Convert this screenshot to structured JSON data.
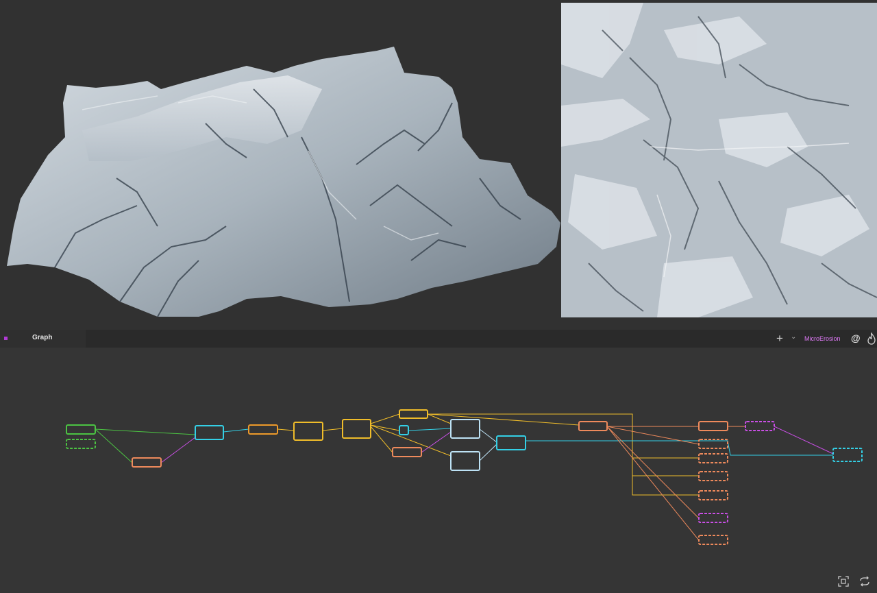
{
  "tabs": {
    "graph_label": "Graph"
  },
  "toolbar": {
    "active_graph": "MicroErosion",
    "add_icon": "plus-icon",
    "dropdown_icon": "chevron-down-icon",
    "at_icon": "at-icon",
    "flame_icon": "flame-icon",
    "frame_icon": "frame-icon",
    "refresh_icon": "refresh-icon"
  },
  "colors": {
    "green": "#4cc443",
    "orange": "#ee8a5c",
    "cyan": "#34d0e6",
    "yellow": "#f0bd2a",
    "lightblue": "#bde2f5",
    "magenta": "#c94fe5",
    "graph_bg": "#353535",
    "tab_accent": "#b13ad6",
    "graph_name": "#e17af8"
  }
}
